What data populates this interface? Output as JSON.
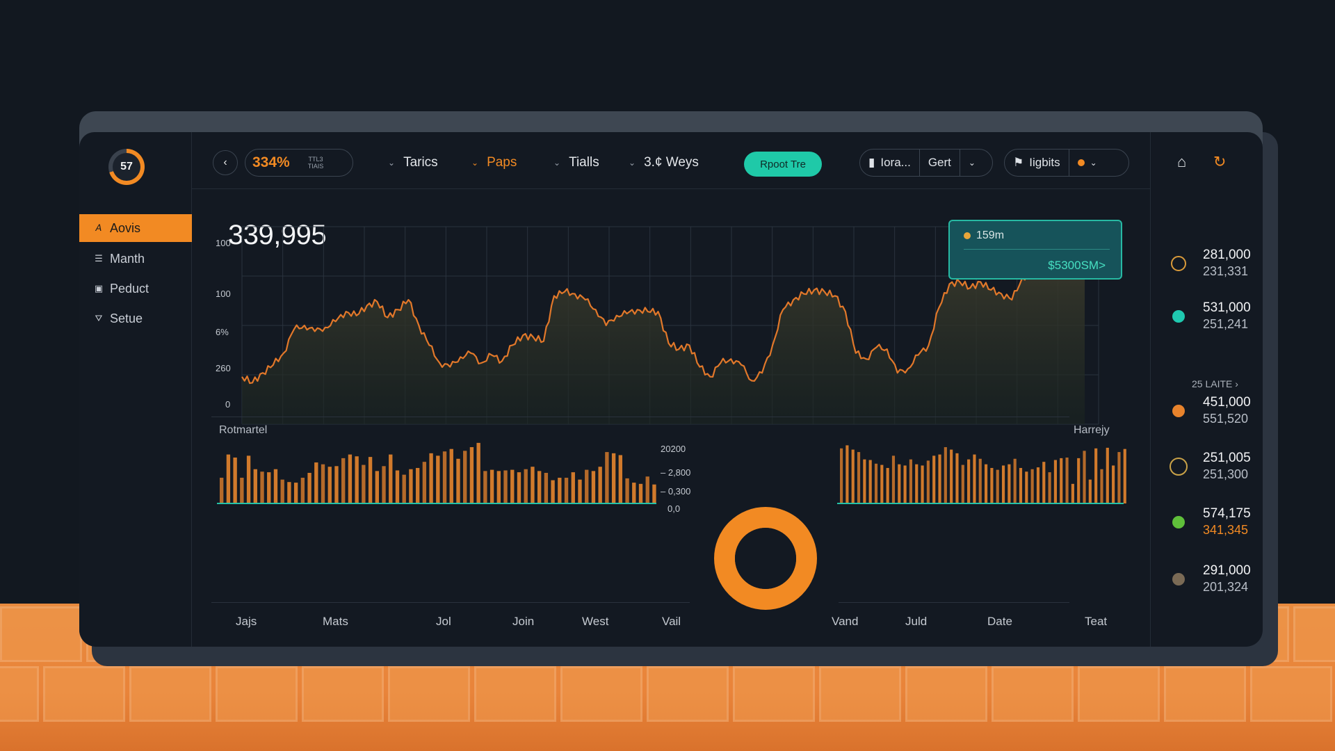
{
  "sidebar": {
    "logo_value": "57",
    "items": [
      {
        "label": "Aovis",
        "icon": "a-icon"
      },
      {
        "label": "Manth",
        "icon": "list-icon"
      },
      {
        "label": "Peduct",
        "icon": "box-icon"
      },
      {
        "label": "Setue",
        "icon": "filter-icon"
      }
    ]
  },
  "toolbar": {
    "percent": "334%",
    "percent_sub1": "TTL3",
    "percent_sub2": "TIAIS",
    "tabs": [
      "Tarics",
      "Paps",
      "Tialls",
      "3.¢ Weys"
    ],
    "cta_label": "Rpoot Tre",
    "seg1": {
      "part1": "Iora...",
      "part2": "Gert"
    },
    "seg2": {
      "part1": "Iigbits"
    },
    "accent": "#f28a23",
    "teal": "#1fc9a8"
  },
  "main_chart": {
    "headline": "339,995",
    "y_ticks": [
      "100",
      "100",
      "6%",
      "260",
      "0"
    ],
    "tooltip_label": "159m",
    "tooltip_value": "$5300SM>"
  },
  "lower": {
    "left_label": "Rotmartel",
    "right_label": "Harrejy",
    "bar_y_ticks": [
      "20200",
      "– 2,800",
      "– 0,300",
      "0,0"
    ],
    "x_labels_left": [
      "Jajs",
      "Mats",
      "Jol",
      "Join",
      "West",
      "Vail"
    ],
    "x_labels_right": [
      "Vand",
      "Juld",
      "Date",
      "Teat"
    ]
  },
  "stats": [
    {
      "v1": "281,000",
      "v2": "231,331",
      "color": "#d99a3a",
      "icon": "compass-icon"
    },
    {
      "v1": "531,000",
      "v2": "251,241",
      "color": "#1fc9b0",
      "icon": "dot-icon"
    },
    {
      "v1": "451,000",
      "v2": "551,520",
      "color": "#e8832c",
      "icon": "dot-icon"
    },
    {
      "v1": "251,005",
      "v2": "251,300",
      "color": "#c9a248",
      "icon": "globe-icon"
    },
    {
      "v1": "574,175",
      "v2": "341,345",
      "color": "#5fbf3a",
      "icon": "dot-icon",
      "v2_orange": true
    },
    {
      "v1": "291,000",
      "v2": "201,324",
      "color": "#7a6a55",
      "icon": "dot-icon"
    }
  ],
  "more_link": "25 LAITE ›",
  "chart_data": [
    {
      "type": "area",
      "title": "",
      "note": "Main line chart, y in chart units 0–100, sampled across the x span",
      "ylim": [
        0,
        100
      ],
      "values": [
        24,
        21,
        26,
        30,
        36,
        48,
        50,
        47,
        49,
        52,
        57,
        55,
        60,
        62,
        54,
        58,
        63,
        50,
        40,
        31,
        29,
        34,
        36,
        31,
        35,
        32,
        40,
        45,
        44,
        42,
        65,
        67,
        66,
        63,
        58,
        50,
        55,
        56,
        58,
        57,
        57,
        41,
        38,
        40,
        29,
        24,
        31,
        33,
        30,
        22,
        26,
        40,
        58,
        63,
        66,
        68,
        67,
        65,
        57,
        36,
        33,
        39,
        38,
        26,
        28,
        35,
        40,
        59,
        71,
        72,
        69,
        72,
        68,
        66,
        63,
        74,
        77,
        75,
        78,
        80,
        79,
        78
      ]
    },
    {
      "type": "bar",
      "title": "",
      "note": "Left bar chart, heights in chart units 0–100",
      "values": [
        42,
        80,
        75,
        42,
        78,
        56,
        52,
        51,
        56,
        39,
        35,
        34,
        42,
        50,
        67,
        64,
        60,
        61,
        74,
        80,
        77,
        63,
        76,
        53,
        61,
        80,
        54,
        47,
        56,
        58,
        68,
        82,
        78,
        85,
        89,
        73,
        86,
        92,
        99,
        53,
        55,
        53,
        54,
        55,
        51,
        56,
        60,
        53,
        50,
        38,
        42,
        42,
        51,
        39,
        55,
        53,
        60,
        84,
        82,
        79,
        41,
        34,
        32,
        44,
        31
      ],
      "ylim": [
        0,
        100
      ]
    },
    {
      "type": "pie",
      "title": "",
      "values": [
        100
      ],
      "note": "Orange donut ring"
    },
    {
      "type": "bar",
      "title": "",
      "note": "Right bar chart, heights in chart units 0–100",
      "values": [
        90,
        95,
        88,
        84,
        72,
        71,
        65,
        63,
        58,
        78,
        64,
        62,
        72,
        64,
        62,
        70,
        78,
        80,
        92,
        88,
        82,
        63,
        72,
        80,
        73,
        64,
        58,
        55,
        62,
        64,
        73,
        58,
        52,
        56,
        59,
        68,
        51,
        71,
        74,
        75,
        32,
        74,
        86,
        39,
        90,
        56,
        91,
        62,
        84,
        89
      ],
      "ylim": [
        0,
        100
      ]
    }
  ]
}
